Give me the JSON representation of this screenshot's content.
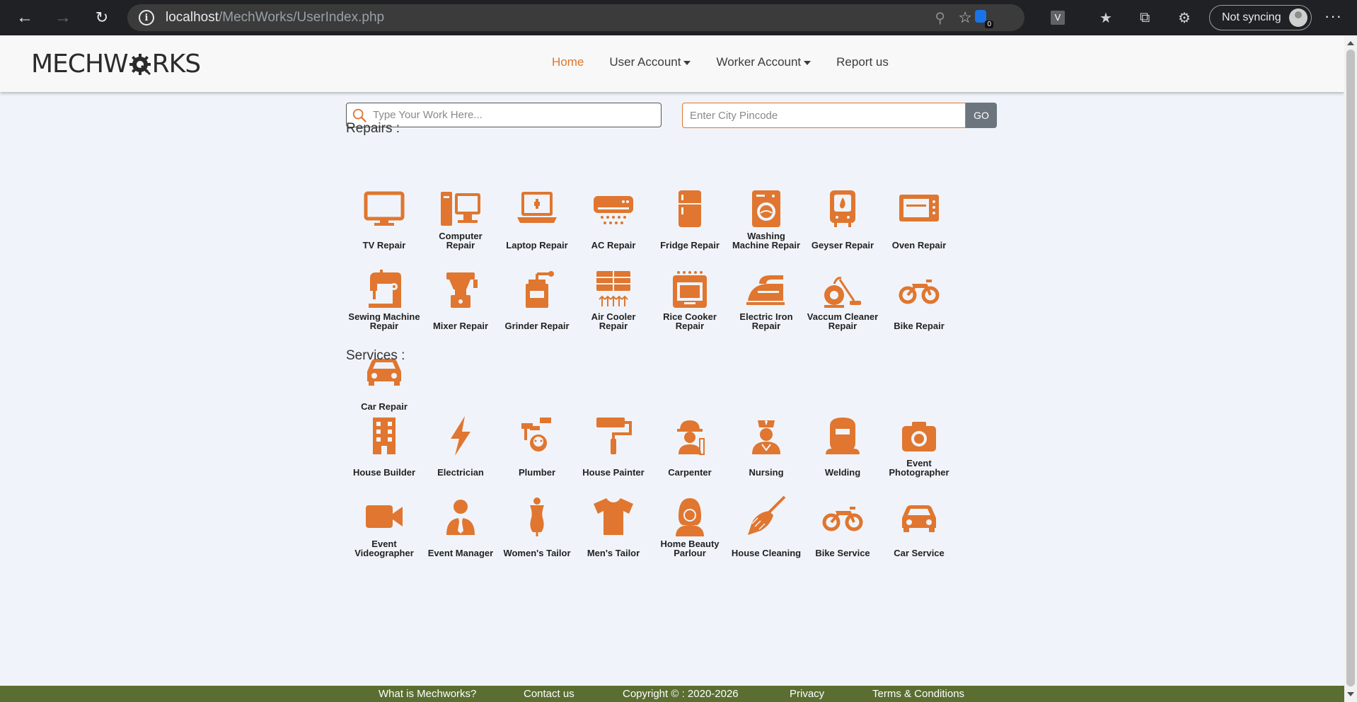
{
  "browser": {
    "url_host": "localhost",
    "url_path": "/MechWorks/UserIndex.php",
    "sync_label": "Not syncing",
    "extension_badge": "0",
    "extension_v": "V"
  },
  "brand": {
    "logo_left": "MECHW",
    "logo_right": "RKS",
    "accent": "#e0762f"
  },
  "nav": {
    "home": "Home",
    "user_account": "User Account",
    "worker_account": "Worker Account",
    "report": "Report us"
  },
  "search": {
    "work_placeholder": "Type Your Work Here...",
    "pincode_placeholder": "Enter City Pincode",
    "go_label": "GO"
  },
  "repairs": {
    "title": "Repairs :",
    "items": [
      {
        "label": "TV Repair",
        "icon": "tv-icon"
      },
      {
        "label": "Computer Repair",
        "icon": "computer-icon"
      },
      {
        "label": "Laptop Repair",
        "icon": "laptop-icon"
      },
      {
        "label": "AC Repair",
        "icon": "ac-icon"
      },
      {
        "label": "Fridge Repair",
        "icon": "fridge-icon"
      },
      {
        "label": "Washing Machine Repair",
        "icon": "washing-machine-icon"
      },
      {
        "label": "Geyser Repair",
        "icon": "geyser-icon"
      },
      {
        "label": "Oven Repair",
        "icon": "oven-icon"
      },
      {
        "label": "Sewing Machine Repair",
        "icon": "sewing-machine-icon"
      },
      {
        "label": "Mixer Repair",
        "icon": "mixer-icon"
      },
      {
        "label": "Grinder Repair",
        "icon": "grinder-icon"
      },
      {
        "label": "Air Cooler Repair",
        "icon": "air-cooler-icon"
      },
      {
        "label": "Rice Cooker Repair",
        "icon": "rice-cooker-icon"
      },
      {
        "label": "Electric Iron Repair",
        "icon": "iron-icon"
      },
      {
        "label": "Vaccum Cleaner Repair",
        "icon": "vacuum-cleaner-icon"
      },
      {
        "label": "Bike Repair",
        "icon": "bike-icon"
      },
      {
        "label": "Car Repair",
        "icon": "car-icon"
      }
    ]
  },
  "services": {
    "title": "Services :",
    "items": [
      {
        "label": "House Builder",
        "icon": "building-icon"
      },
      {
        "label": "Electrician",
        "icon": "lightning-icon"
      },
      {
        "label": "Plumber",
        "icon": "plumber-icon"
      },
      {
        "label": "House Painter",
        "icon": "paint-roller-icon"
      },
      {
        "label": "Carpenter",
        "icon": "carpenter-icon"
      },
      {
        "label": "Nursing",
        "icon": "nurse-icon"
      },
      {
        "label": "Welding",
        "icon": "welding-mask-icon"
      },
      {
        "label": "Event Photographer",
        "icon": "camera-icon"
      },
      {
        "label": "Event Videographer",
        "icon": "video-camera-icon"
      },
      {
        "label": "Event Manager",
        "icon": "manager-icon"
      },
      {
        "label": "Women's Tailor",
        "icon": "dress-form-icon"
      },
      {
        "label": "Men's Tailor",
        "icon": "tshirt-icon"
      },
      {
        "label": "Home Beauty Parlour",
        "icon": "beauty-icon"
      },
      {
        "label": "House Cleaning",
        "icon": "broom-icon"
      },
      {
        "label": "Bike Service",
        "icon": "bike-icon"
      },
      {
        "label": "Car Service",
        "icon": "car-icon"
      }
    ]
  },
  "footer": {
    "what": "What is Mechworks?",
    "contact": "Contact us",
    "copyright": "Copyright © : 2020-2026",
    "privacy": "Privacy",
    "terms": "Terms & Conditions"
  }
}
